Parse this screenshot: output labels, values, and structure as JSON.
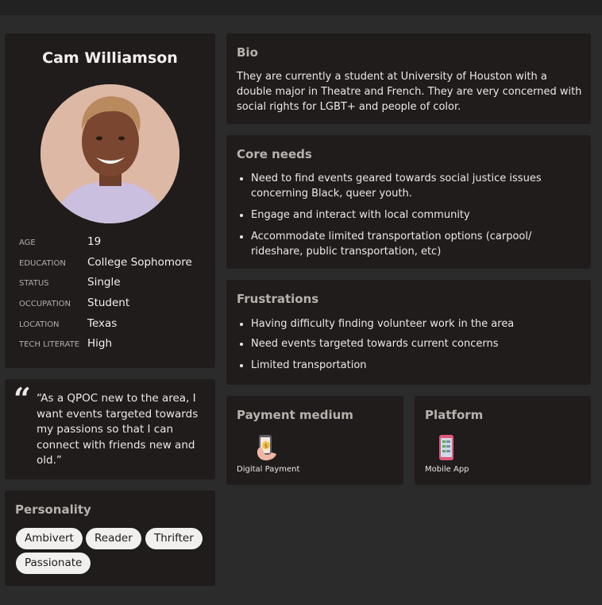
{
  "profile": {
    "name": "Cam Williamson",
    "info": [
      {
        "key": "AGE",
        "value": "19"
      },
      {
        "key": "EDUCATION",
        "value": "College Sophomore"
      },
      {
        "key": "STATUS",
        "value": "Single"
      },
      {
        "key": "OCCUPATION",
        "value": "Student"
      },
      {
        "key": "LOCATION",
        "value": "Texas"
      },
      {
        "key": "TECH LITERATE",
        "value": "High"
      }
    ]
  },
  "quote": {
    "mark": "“",
    "text": "“As a QPOC new to the area, I want events targeted towards my passions so that I can connect with friends new and old.”"
  },
  "personality": {
    "title": "Personality",
    "tags": [
      "Ambivert",
      "Reader",
      "Thrifter",
      "Passionate"
    ]
  },
  "bio": {
    "title": "Bio",
    "text": "They are currently a student at University of Houston with a double major in Theatre and French. They are very concerned with social rights for LGBT+ and people of color."
  },
  "core_needs": {
    "title": "Core needs",
    "items": [
      "Need to find events geared towards social justice issues concerning Black, queer youth.",
      "Engage and interact with local community",
      "Accommodate limited transportation options (carpool/ rideshare, public transportation, etc)"
    ]
  },
  "frustrations": {
    "title": "Frustrations",
    "items": [
      "Having difficulty finding volunteer work in the area",
      "Need events targeted towards current concerns",
      "Limited transportation"
    ]
  },
  "payment": {
    "title": "Payment medium",
    "label": "Digital Payment",
    "icon": "phone-payment-icon"
  },
  "platform": {
    "title": "Platform",
    "label": "Mobile App",
    "icon": "mobile-app-icon"
  },
  "colors": {
    "background": "#2b2b2b",
    "card": "#1f1c1b",
    "title": "#b8b2ae",
    "tag_bg": "#f1f0ee"
  }
}
